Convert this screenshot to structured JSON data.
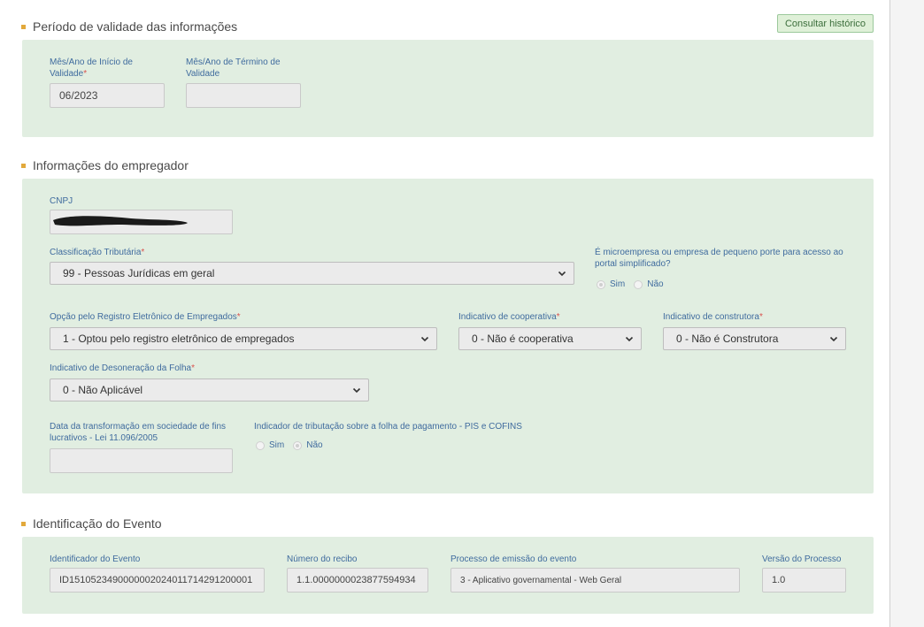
{
  "periodo": {
    "title": "Período de validade das informações",
    "historico_button": "Consultar histórico",
    "inicio_label": "Mês/Ano de Início de Validade",
    "inicio_value": "06/2023",
    "termino_label": "Mês/Ano de Término de Validade",
    "termino_value": ""
  },
  "empregador": {
    "title": "Informações do empregador",
    "cnpj_label": "CNPJ",
    "classificacao_label": "Classificação Tributária",
    "classificacao_value": "99 - Pessoas Jurídicas em geral",
    "microempresa_label": "É microempresa ou empresa de pequeno porte para acesso ao portal simplificado?",
    "microempresa_sim": "Sim",
    "microempresa_nao": "Não",
    "registro_label": "Opção pelo Registro Eletrônico de Empregados",
    "registro_value": "1 - Optou pelo registro eletrônico de empregados",
    "cooperativa_label": "Indicativo de cooperativa",
    "cooperativa_value": "0 - Não é cooperativa",
    "construtora_label": "Indicativo de construtora",
    "construtora_value": "0 - Não é Construtora",
    "desoneracao_label": "Indicativo de Desoneração da Folha",
    "desoneracao_value": "0 - Não Aplicável",
    "transformacao_label": "Data da transformação em sociedade de fins lucrativos - Lei 11.096/2005",
    "transformacao_value": "",
    "pis_label": "Indicador de tributação sobre a folha de pagamento - PIS e COFINS",
    "pis_sim": "Sim",
    "pis_nao": "Não"
  },
  "evento": {
    "title": "Identificação do Evento",
    "identificador_label": "Identificador do Evento",
    "identificador_value": "ID1510523490000002024011714291200001",
    "recibo_label": "Número do recibo",
    "recibo_value": "1.1.0000000023877594934",
    "processo_label": "Processo de emissão do evento",
    "processo_value": "3 - Aplicativo governamental - Web Geral",
    "versao_label": "Versão do Processo",
    "versao_value": "1.0"
  },
  "colors": {
    "panel": "#e1eee1",
    "label": "#3f6b9e",
    "required": "#d9534f",
    "bullet": "#e2a93b"
  }
}
